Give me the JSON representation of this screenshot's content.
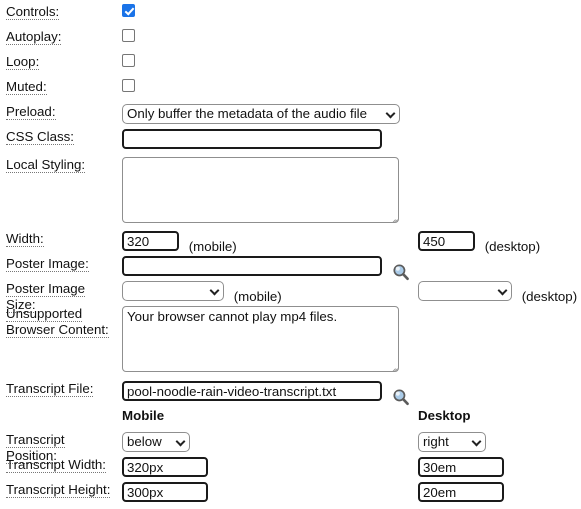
{
  "form": {
    "rows": {
      "controls": {
        "label": "Controls:",
        "checked": true
      },
      "autoplay": {
        "label": "Autoplay:",
        "checked": false
      },
      "loop": {
        "label": "Loop:",
        "checked": false
      },
      "muted": {
        "label": "Muted:",
        "checked": false
      },
      "preload": {
        "label": "Preload:",
        "value": "Only buffer the metadata of the audio file"
      },
      "css_class": {
        "label": "CSS Class:",
        "value": ""
      },
      "local_styling": {
        "label": "Local Styling:",
        "value": ""
      },
      "width": {
        "label": "Width:",
        "mobile_value": "320",
        "mobile_suffix": "(mobile)",
        "desktop_value": "450",
        "desktop_suffix": "(desktop)"
      },
      "poster_image": {
        "label": "Poster Image:",
        "value": "",
        "browse_icon": "magnifier-icon"
      },
      "poster_image_size": {
        "label": "Poster Image Size:",
        "mobile_value": "",
        "mobile_suffix": "(mobile)",
        "desktop_value": "",
        "desktop_suffix": "(desktop)"
      },
      "unsupported_browser_content": {
        "label_line1": "Unsupported",
        "label_line2": "Browser Content:",
        "value": "Your browser cannot play mp4 files."
      },
      "transcript_file": {
        "label": "Transcript File:",
        "value": "pool-noodle-rain-video-transcript.txt",
        "browse_icon": "magnifier-icon"
      },
      "column_headers": {
        "mobile": "Mobile",
        "desktop": "Desktop"
      },
      "transcript_position": {
        "label": "Transcript Position:",
        "mobile_value": "below",
        "desktop_value": "right"
      },
      "transcript_width": {
        "label": "Transcript Width:",
        "mobile_value": "320px",
        "desktop_value": "30em"
      },
      "transcript_height": {
        "label": "Transcript Height:",
        "mobile_value": "300px",
        "desktop_value": "20em"
      }
    }
  },
  "colors": {
    "checkbox_checked": "#1a73e8",
    "input_border_dark": "#1a1a1a",
    "input_border_light": "#8f8f8f",
    "text": "#111111",
    "magnifier_lens": "#aacbe8"
  }
}
